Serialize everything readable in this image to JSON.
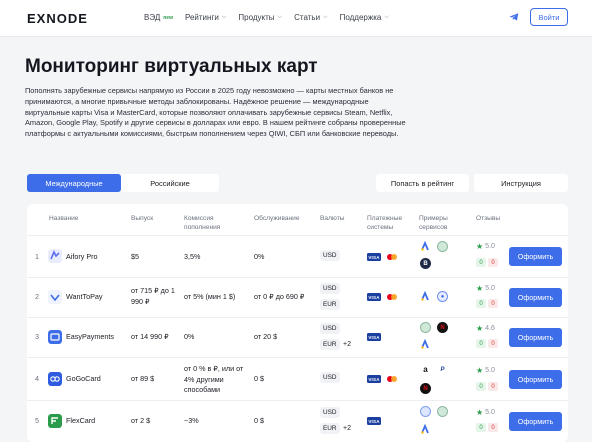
{
  "header": {
    "logo": "EXNODE",
    "nav": [
      {
        "label": "ВЭД",
        "badge": "new",
        "chevron": false
      },
      {
        "label": "Рейтинги",
        "chevron": true
      },
      {
        "label": "Продукты",
        "chevron": true
      },
      {
        "label": "Статьи",
        "chevron": true
      },
      {
        "label": "Поддержка",
        "chevron": true
      }
    ],
    "login": "Войти"
  },
  "page": {
    "title": "Мониторинг виртуальных карт",
    "intro": "Пополнять зарубежные сервисы напрямую из России в 2025 году невозможно — карты местных банков не принимаются, а многие привычные методы заблокированы. Надёжное решение — международные виртуальные карты Visa и MasterCard, которые позволяют оплачивать зарубежные сервисы Steam, Netflix, Amazon, Google Play, Spotify и другие сервисы в долларах или евро. В нашем рейтинге собраны проверенные платформы с актуальными комиссиями, быстрым пополнением через QIWI, СБП или банковские переводы."
  },
  "tabs": {
    "international": "Международные",
    "russian": "Российские"
  },
  "actions": {
    "add_to_rating": "Попасть в рейтинг",
    "guide": "Инструкция"
  },
  "table": {
    "headers": {
      "name": "Название",
      "issue": "Выпуск",
      "fee_line1": "Комиссия",
      "fee_line2": "пополнения",
      "service": "Обслуживание",
      "currencies": "Валюты",
      "pay_line1": "Платежные",
      "pay_line2": "системы",
      "examples_line1": "Примеры",
      "examples_line2": "сервисов",
      "reviews": "Отзывы"
    },
    "cta": "Оформить",
    "rows": [
      {
        "n": "1",
        "name": "Aifory Pro",
        "issue": "$5",
        "fee": "3,5%",
        "service": "0%",
        "cur1": "USD",
        "cur2": "",
        "more": "",
        "rating": "5.0",
        "pos": "0",
        "neg": "0",
        "icon_color": "#e9ecff"
      },
      {
        "n": "2",
        "name": "WantToPay",
        "issue": "от 715 ₽ до 1 990 ₽",
        "fee": "от 5% (мин 1 $)",
        "service": "от 0 ₽ до 690 ₽",
        "cur1": "USD",
        "cur2": "EUR",
        "more": "",
        "rating": "5.0",
        "pos": "0",
        "neg": "0",
        "icon_color": "#eef3ff"
      },
      {
        "n": "3",
        "name": "EasyPayments",
        "issue": "от 14 990 ₽",
        "fee": "0%",
        "service": "от 20 $",
        "cur1": "USD",
        "cur2": "EUR",
        "more": "+2",
        "rating": "4.6",
        "pos": "0",
        "neg": "0",
        "icon_color": "#3d6de8"
      },
      {
        "n": "4",
        "name": "GoGoCard",
        "issue": "от 89 $",
        "fee": "от 0 % в ₽, или от 4% другими способами",
        "service": "0 $",
        "cur1": "USD",
        "cur2": "",
        "more": "",
        "rating": "5.0",
        "pos": "0",
        "neg": "0",
        "icon_color": "#2e5be0"
      },
      {
        "n": "5",
        "name": "FlexCard",
        "issue": "от 2 $",
        "fee": "~3%",
        "service": "0 $",
        "cur1": "USD",
        "cur2": "EUR",
        "more": "+2",
        "rating": "5.0",
        "pos": "0",
        "neg": "0",
        "icon_color": "#2a9b4a"
      }
    ]
  }
}
